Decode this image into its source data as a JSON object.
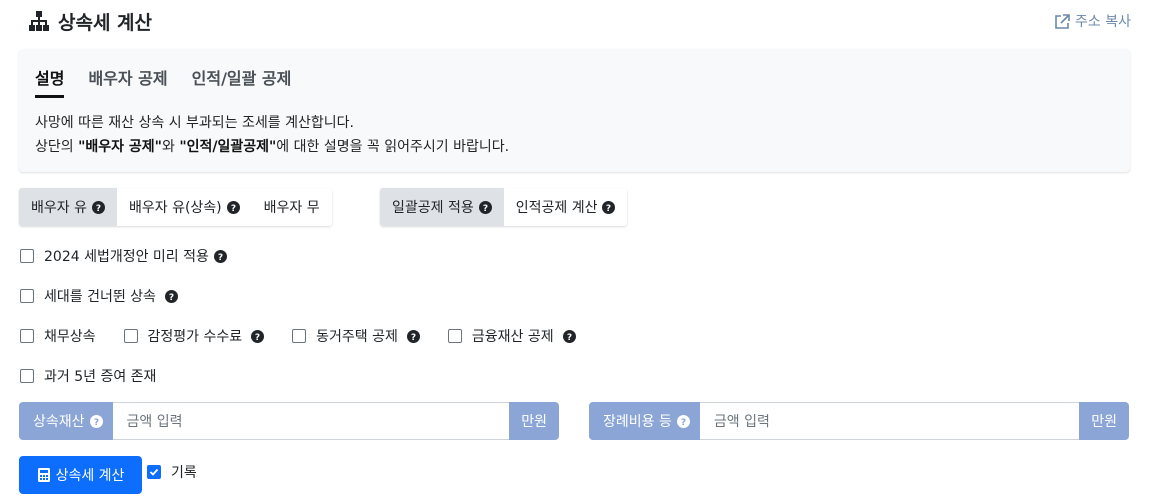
{
  "header": {
    "title": "상속세 계산",
    "icon": "sitemap-icon",
    "copy_label": "주소 복사",
    "copy_icon": "share-icon"
  },
  "info": {
    "tabs": [
      {
        "label": "설명",
        "active": true
      },
      {
        "label": "배우자 공제",
        "active": false
      },
      {
        "label": "인적/일괄 공제",
        "active": false
      }
    ],
    "line1": "사망에 따른 재산 상속 시 부과되는 조세를 계산합니다.",
    "line2_pre": "상단의 ",
    "line2_b1": "\"배우자 공제\"",
    "line2_mid": "와 ",
    "line2_b2": "\"인적/일괄공제\"",
    "line2_post": "에 대한 설명을 꼭 읽어주시기 바랍니다."
  },
  "spouse_group": {
    "options": [
      {
        "label": "배우자 유",
        "active": true,
        "help": true
      },
      {
        "label": "배우자 유(상속)",
        "active": false,
        "help": true
      },
      {
        "label": "배우자 무",
        "active": false,
        "help": false
      }
    ]
  },
  "deduction_group": {
    "options": [
      {
        "label": "일괄공제 적용",
        "active": true,
        "help": true
      },
      {
        "label": "인적공제 계산",
        "active": false,
        "help": true
      }
    ]
  },
  "checks": {
    "reform": "2024 세법개정안 미리 적용",
    "skip_generation": "세대를 건너뛴 상속",
    "debt": "채무상속",
    "appraisal_fee": "감정평가 수수료",
    "cohabiting_house": "동거주택 공제",
    "financial_assets": "금융재산 공제",
    "past_gift": "과거 5년 증여 존재"
  },
  "inputs": {
    "estate": {
      "label": "상속재산",
      "placeholder": "금액 입력",
      "unit": "만원"
    },
    "funeral": {
      "label": "장례비용 등",
      "placeholder": "금액 입력",
      "unit": "만원"
    }
  },
  "actions": {
    "calc_label": "상속세 계산",
    "record_label": "기록",
    "record_checked": true
  },
  "colors": {
    "primary": "#0d6efd",
    "input_addon": "#8aa5d6",
    "link": "#6c88a8"
  }
}
